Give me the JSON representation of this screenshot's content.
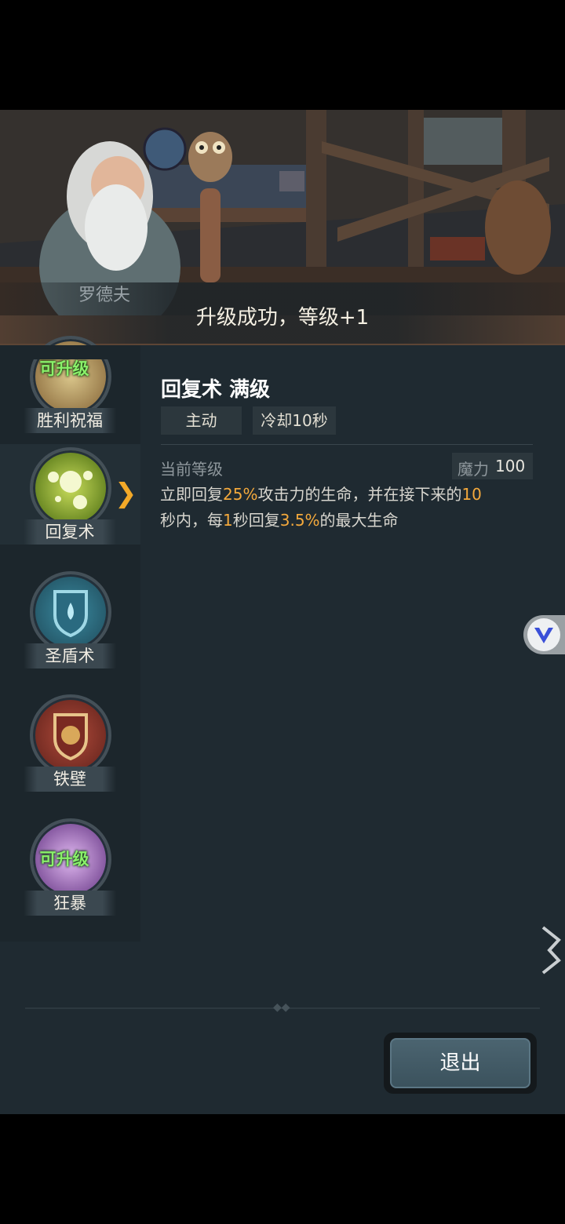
{
  "scene": {
    "npc_name": "罗德夫",
    "notification": "升级成功，等级+1"
  },
  "skills": [
    {
      "label": "胜利祝福",
      "badge": "可升级",
      "icon": "blessing-icon"
    },
    {
      "label": "回复术",
      "badge": "",
      "icon": "heal-orb-icon",
      "selected": true
    },
    {
      "label": "圣盾术",
      "badge": "",
      "icon": "holy-shield-icon"
    },
    {
      "label": "铁壁",
      "badge": "",
      "icon": "iron-wall-icon"
    },
    {
      "label": "狂暴",
      "badge": "可升级",
      "icon": "berserk-icon"
    }
  ],
  "detail": {
    "title": "回复术 满级",
    "type": "主动",
    "cooldown": "冷却10秒",
    "level_label": "当前等级",
    "mana_label": "魔力",
    "mana_value": "100",
    "desc": {
      "p1": "立即回复",
      "v1": "25%",
      "p2": "攻击力的生命，并在接下来的",
      "v2": "10",
      "p3": "秒内，每",
      "v3": "1",
      "p4": "秒回复",
      "v4": "3.5%",
      "p5": "的最大生命"
    }
  },
  "buttons": {
    "exit": "退出"
  },
  "colors": {
    "highlight": "#f4a93c",
    "badge_green": "#8af06a",
    "panel": "#1f2a31"
  }
}
